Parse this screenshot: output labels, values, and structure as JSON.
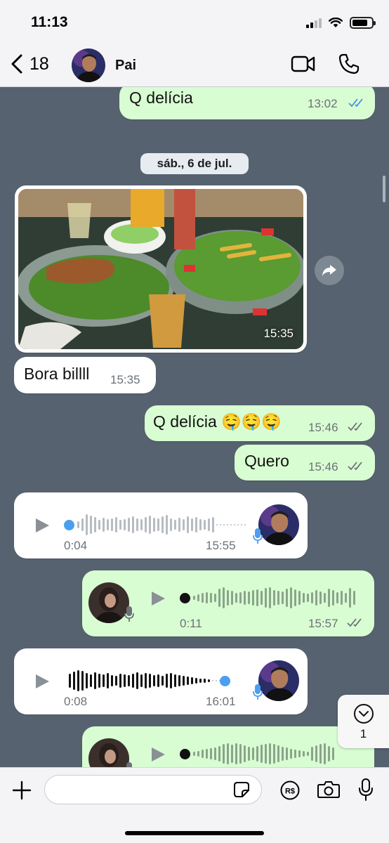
{
  "status_bar": {
    "time": "11:13"
  },
  "header": {
    "back_count": "18",
    "contact_name": "Pai"
  },
  "chat": {
    "messages": [
      {
        "text": "Q delícia",
        "time": "13:02"
      },
      {
        "date_separator": "sáb., 6 de jul."
      },
      {
        "photo_time": "15:35"
      },
      {
        "text": "Bora billll",
        "time": "15:35"
      },
      {
        "text": "Q delícia 🤤🤤🤤",
        "time": "15:46"
      },
      {
        "text": "Quero",
        "time": "15:46"
      },
      {
        "voice_duration": "0:04",
        "time": "15:55",
        "played_fraction": 0.0
      },
      {
        "voice_duration": "0:11",
        "time": "15:57",
        "played_fraction": 0.0
      },
      {
        "voice_duration": "0:08",
        "time": "16:01",
        "played_fraction": 0.88
      }
    ],
    "unread_jump_count": "1"
  },
  "composer": {
    "placeholder": ""
  },
  "colors": {
    "chat_background": "#56626f",
    "outgoing_bubble": "#d9fdd3",
    "incoming_bubble": "#ffffff",
    "read_ticks": "#4a90e2",
    "voice_progress": "#4a9ff0"
  },
  "icons": [
    "back-chevron",
    "video-camera",
    "phone",
    "forward-arrow",
    "play",
    "microphone",
    "chevron-down",
    "plus",
    "sticker",
    "pix-payment",
    "camera"
  ]
}
